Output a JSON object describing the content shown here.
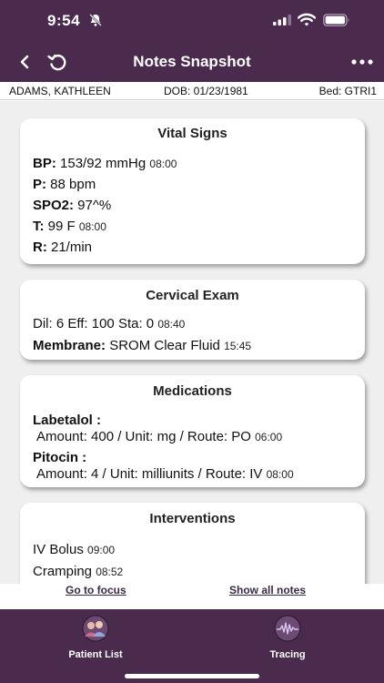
{
  "status": {
    "time": "9:54"
  },
  "nav": {
    "title": "Notes Snapshot"
  },
  "patient": {
    "name": "ADAMS, KATHLEEN",
    "dob": "DOB: 01/23/1981",
    "bed": "Bed: GTRI1"
  },
  "vitals": {
    "title": "Vital Signs",
    "rows": [
      {
        "label": "BP:",
        "value": " 153/92 mmHg ",
        "time": "08:00"
      },
      {
        "label": "P:",
        "value": " 88 bpm",
        "time": ""
      },
      {
        "label": "SPO2:",
        "value": " 97^%",
        "time": ""
      },
      {
        "label": "T:",
        "value": " 99 F ",
        "time": "08:00"
      },
      {
        "label": "R:",
        "value": " 21/min",
        "time": ""
      }
    ]
  },
  "cervical": {
    "title": "Cervical Exam",
    "line1": "Dil: 6 Eff: 100 Sta: 0 ",
    "line1_time": "08:40",
    "membrane_label": "Membrane:",
    "membrane_value": " SROM Clear Fluid ",
    "membrane_time": "15:45"
  },
  "medications": {
    "title": "Medications",
    "items": [
      {
        "name": "Labetalol :",
        "detail": "Amount: 400 / Unit: mg / Route: PO ",
        "time": "06:00"
      },
      {
        "name": "Pitocin :",
        "detail": "Amount: 4 / Unit: milliunits / Route: IV ",
        "time": "08:00"
      }
    ]
  },
  "interventions": {
    "title": "Interventions",
    "items": [
      {
        "text": "IV Bolus ",
        "time": "09:00"
      },
      {
        "text": "Cramping ",
        "time": "08:52"
      }
    ]
  },
  "links": {
    "focus": "Go to focus",
    "all_notes": "Show all notes"
  },
  "tabs": {
    "patient_list": "Patient List",
    "tracing": "Tracing"
  },
  "colors": {
    "header": "#4a2a4d",
    "link": "#3a2a45",
    "content_bg": "#efefef"
  }
}
